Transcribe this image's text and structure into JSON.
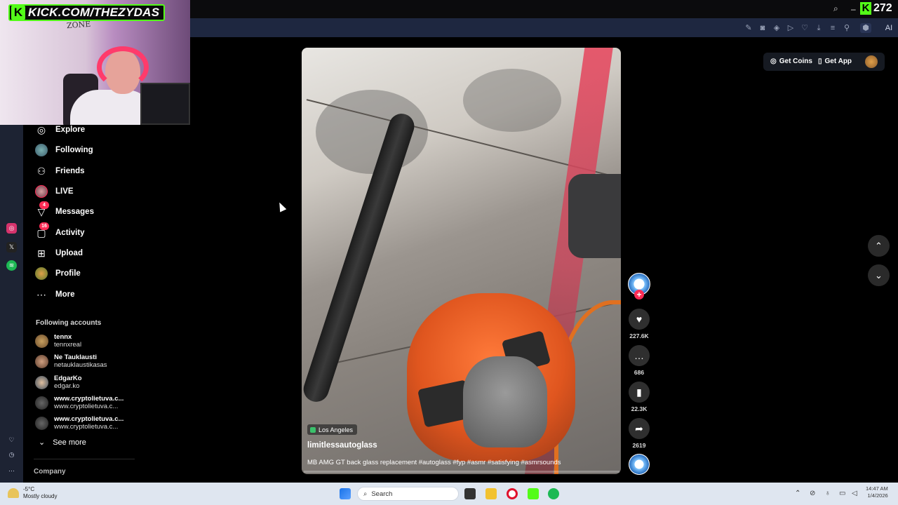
{
  "stream_overlay": {
    "kick_handle": "KICK.COM/THEZYDAS",
    "viewer_count": "272",
    "graffiti": "ZONE"
  },
  "sidebar": {
    "items": [
      {
        "label": "Explore",
        "icon": "compass-icon"
      },
      {
        "label": "Following",
        "icon": "following-avatar-icon"
      },
      {
        "label": "Friends",
        "icon": "friends-icon"
      },
      {
        "label": "LIVE",
        "icon": "live-icon"
      },
      {
        "label": "Messages",
        "icon": "messages-icon",
        "badge": "4"
      },
      {
        "label": "Activity",
        "icon": "activity-icon",
        "badge": "16"
      },
      {
        "label": "Upload",
        "icon": "upload-icon"
      },
      {
        "label": "Profile",
        "icon": "profile-avatar-icon"
      },
      {
        "label": "More",
        "icon": "more-icon"
      }
    ],
    "following_title": "Following accounts",
    "following": [
      {
        "name": "tennx",
        "handle": "tennxreal"
      },
      {
        "name": "Ne Tauklausti",
        "handle": "netauklaustikasas"
      },
      {
        "name": "EdgarKo",
        "handle": "edgar.ko"
      },
      {
        "name": "www.cryptolietuva.c...",
        "handle": "www.cryptolietuva.c..."
      },
      {
        "name": "www.cryptolietuva.c...",
        "handle": "www.cryptolietuva.c..."
      }
    ],
    "see_more": "See more",
    "company": "Company"
  },
  "video": {
    "location": "Los Angeles",
    "author": "limitlessautoglass",
    "caption": "MB AMG GT back glass replacement #autoglass #fyp #asmr #satisfying #asmrsounds",
    "progress": 0.0
  },
  "actions": {
    "likes": "227.6K",
    "comments": "686",
    "saves": "22.3K",
    "shares": "2619"
  },
  "header": {
    "get_coins": "Get Coins",
    "get_app": "Get App"
  },
  "taskbar": {
    "temp": "-5°C",
    "condition": "Mostly cloudy",
    "search_placeholder": "Search",
    "time": "14:47 AM",
    "date": "1/4/2026"
  },
  "colors": {
    "accent": "#fe2c55",
    "kick_green": "#53fc18",
    "browser_bar": "#1e2740"
  }
}
